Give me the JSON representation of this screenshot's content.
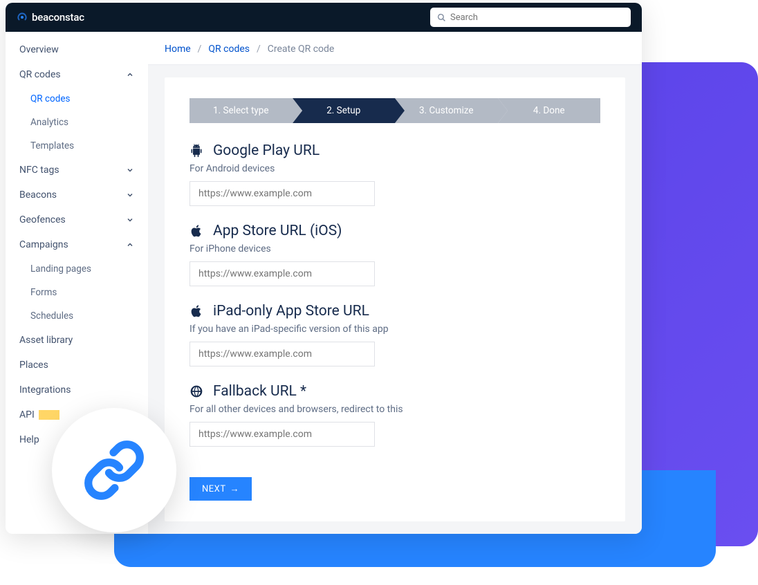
{
  "brand": "beaconstac",
  "search": {
    "placeholder": "Search"
  },
  "sidebar": {
    "overview": "Overview",
    "qrcodes": "QR codes",
    "qrcodes_sub": [
      "QR codes",
      "Analytics",
      "Templates"
    ],
    "nfc": "NFC tags",
    "beacons": "Beacons",
    "geofences": "Geofences",
    "campaigns": "Campaigns",
    "campaigns_sub": [
      "Landing pages",
      "Forms",
      "Schedules"
    ],
    "asset": "Asset library",
    "places": "Places",
    "integrations": "Integrations",
    "api": "API",
    "help": "Help"
  },
  "breadcrumb": {
    "home": "Home",
    "qr": "QR codes",
    "current": "Create QR code"
  },
  "steps": [
    "1. Select type",
    "2. Setup",
    "3. Customize",
    "4. Done"
  ],
  "form": {
    "google": {
      "title": "Google Play URL",
      "sub": "For Android devices",
      "placeholder": "https://www.example.com"
    },
    "ios": {
      "title": "App Store URL (iOS)",
      "sub": "For iPhone devices",
      "placeholder": "https://www.example.com"
    },
    "ipad": {
      "title": "iPad-only App Store URL",
      "sub": "If you have an iPad-specific version of this app",
      "placeholder": "https://www.example.com"
    },
    "fallback": {
      "title": "Fallback URL *",
      "sub": "For all other devices and browsers, redirect to this",
      "placeholder": "https://www.example.com"
    }
  },
  "next_label": "NEXT"
}
